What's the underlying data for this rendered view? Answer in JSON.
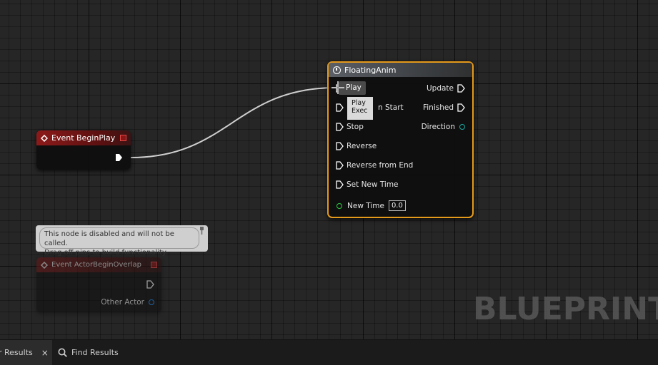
{
  "timeline_node": {
    "title": "FloatingAnim",
    "inputs": [
      "Play",
      "Play from Start",
      "Stop",
      "Reverse",
      "Reverse from End",
      "Set New Time"
    ],
    "inputs_visible": [
      "Play",
      "n Start",
      "Stop",
      "Reverse",
      "Reverse from End",
      "Set New Time"
    ],
    "new_time_label": "New Time",
    "new_time_value": "0.0",
    "outputs": {
      "update": "Update",
      "finished": "Finished",
      "direction": "Direction"
    }
  },
  "tooltip": {
    "line1": "Play",
    "line2": "Exec"
  },
  "beginplay_node": {
    "title": "Event BeginPlay"
  },
  "overlap_node": {
    "title": "Event ActorBeginOverlap",
    "other_actor": "Other Actor",
    "comment_line1": "This node is disabled and will not be called.",
    "comment_line2": "Drag off pins to build functionality."
  },
  "watermark": "BLUEPRINT",
  "bottom_tabs": {
    "tab1": "r Results",
    "tab1_close": "×",
    "tab2": "Find Results"
  },
  "colors": {
    "accent_selected": "#e59a1b",
    "event_red": "#8c1a1a",
    "float_pin": "#2ecc40",
    "object_pin": "#1e90ff",
    "struct_pin": "#1aa6a0"
  },
  "icons": [
    "clock-icon",
    "exec-pin-icon",
    "search-icon",
    "close-icon",
    "pin-icon"
  ]
}
